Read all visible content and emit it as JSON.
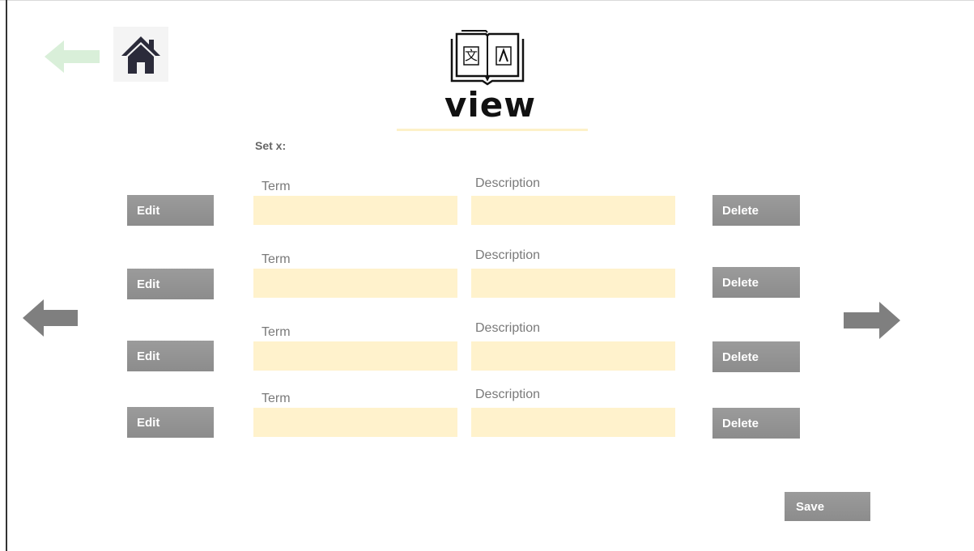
{
  "header": {
    "title": "view",
    "back_icon": "back-arrow-icon",
    "home_icon": "home-icon",
    "logo_icon": "translate-book-icon"
  },
  "set_label": "Set x:",
  "rows": [
    {
      "edit_label": "Edit",
      "term_label": "Term",
      "term_value": "",
      "desc_label": "Description",
      "desc_value": "",
      "delete_label": "Delete"
    },
    {
      "edit_label": "Edit",
      "term_label": "Term",
      "term_value": "",
      "desc_label": "Description",
      "desc_value": "",
      "delete_label": "Delete"
    },
    {
      "edit_label": "Edit",
      "term_label": "Term",
      "term_value": "",
      "desc_label": "Description",
      "desc_value": "",
      "delete_label": "Delete"
    },
    {
      "edit_label": "Edit",
      "term_label": "Term",
      "term_value": "",
      "desc_label": "Description",
      "desc_value": "",
      "delete_label": "Delete"
    }
  ],
  "navigation": {
    "prev_icon": "arrow-left-icon",
    "next_icon": "arrow-right-icon"
  },
  "save_label": "Save",
  "colors": {
    "field_fill": "#fff2cc",
    "button_fill": "#8c8c8c",
    "back_arrow": "#d9efd9",
    "nav_arrow": "#7f7f7f",
    "icon_dark": "#2b2b3a"
  }
}
